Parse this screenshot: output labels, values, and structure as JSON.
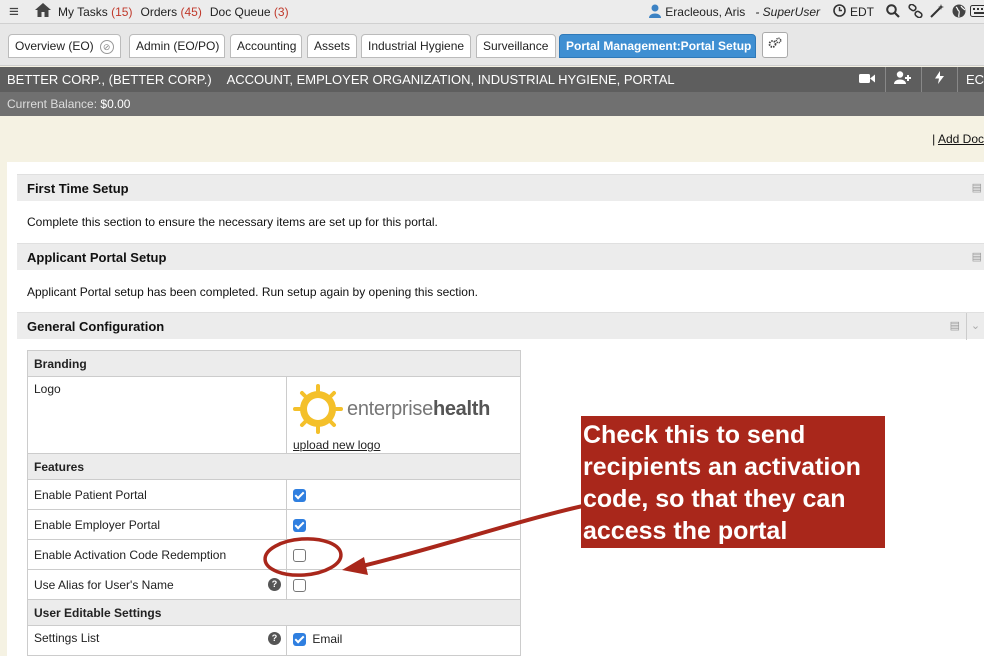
{
  "topbar": {
    "links": [
      {
        "label": "My Tasks",
        "count": "(15)"
      },
      {
        "label": "Orders",
        "count": "(45)"
      },
      {
        "label": "Doc Queue",
        "count": "(3)"
      }
    ],
    "user": "Eracleous, Aris",
    "role": "- SuperUser",
    "timezone": "EDT"
  },
  "tabs": [
    {
      "label": "Overview (EO)"
    },
    {
      "label": "Admin (EO/PO)"
    },
    {
      "label": "Accounting"
    },
    {
      "label": "Assets"
    },
    {
      "label": "Industrial Hygiene"
    },
    {
      "label": "Surveillance"
    },
    {
      "label": "Portal Management:Portal Setup"
    }
  ],
  "account": {
    "name": "BETTER CORP., (BETTER CORP.)",
    "types": "ACCOUNT, EMPLOYER ORGANIZATION, INDUSTRIAL HYGIENE, PORTAL",
    "trailing": "EC",
    "balance_label": "Current Balance:",
    "balance_value": "$0.00"
  },
  "add_doc": {
    "prefix": "|",
    "label": "Add Doc"
  },
  "sections": [
    {
      "title": "First Time Setup",
      "description": "Complete this section to ensure the necessary items are set up for this portal."
    },
    {
      "title": "Applicant Portal Setup",
      "description": "Applicant Portal setup has been completed. Run setup again by opening this section."
    },
    {
      "title": "General Configuration"
    }
  ],
  "config": {
    "branding_header": "Branding",
    "logo_label": "Logo",
    "logo_text_light": "enterprise",
    "logo_text_bold": "health",
    "upload_label": "upload new logo",
    "features_header": "Features",
    "features": [
      {
        "label": "Enable Patient Portal",
        "checked": true
      },
      {
        "label": "Enable Employer Portal",
        "checked": true
      },
      {
        "label": "Enable Activation Code Redemption",
        "checked": false
      },
      {
        "label": "Use Alias for User's Name",
        "checked": false,
        "help": true
      }
    ],
    "editable_header": "User Editable Settings",
    "settings_list_label": "Settings List",
    "settings_list_value": "Email",
    "settings_list_checked": true
  },
  "callout": {
    "text": "Check this to send recipients an activation code, so that they can access the portal",
    "color": "#a9271b"
  }
}
